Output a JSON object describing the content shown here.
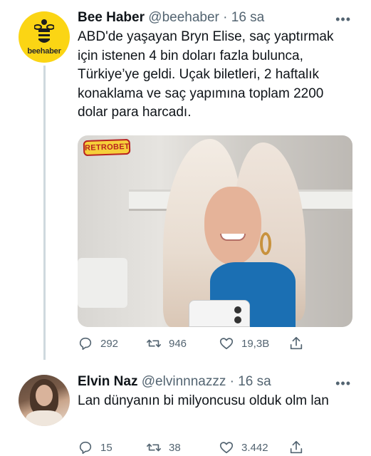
{
  "tweets": [
    {
      "display_name": "Bee Haber",
      "handle": "@beehaber",
      "separator": "·",
      "time": "16 sa",
      "avatar_brand": "beehaber",
      "text": "ABD'de yaşayan Bryn Elise, saç yaptırmak için istenen 4 bin doları fazla bulunca, Türkiye’ye geldi. Uçak biletleri, 2 haftalık konaklama ve saç yapımına toplam 2200 dolar para harcadı.",
      "media_watermark": "RETROBET",
      "stats": {
        "replies": "292",
        "retweets": "946",
        "likes": "19,3B"
      }
    },
    {
      "display_name": "Elvin Naz",
      "handle": "@elvinnnazzz",
      "separator": "·",
      "time": "16 sa",
      "text": "Lan dünyanın bi milyoncusu olduk olm lan",
      "stats": {
        "replies": "15",
        "retweets": "38",
        "likes": "3.442"
      }
    }
  ],
  "icons": {
    "more": "more-horizontal-icon",
    "reply": "reply-icon",
    "retweet": "retweet-icon",
    "like": "heart-icon",
    "share": "share-icon"
  },
  "colors": {
    "secondary_text": "#536471",
    "thread_line": "#cfd9de",
    "bee_yellow": "#fbd514"
  }
}
